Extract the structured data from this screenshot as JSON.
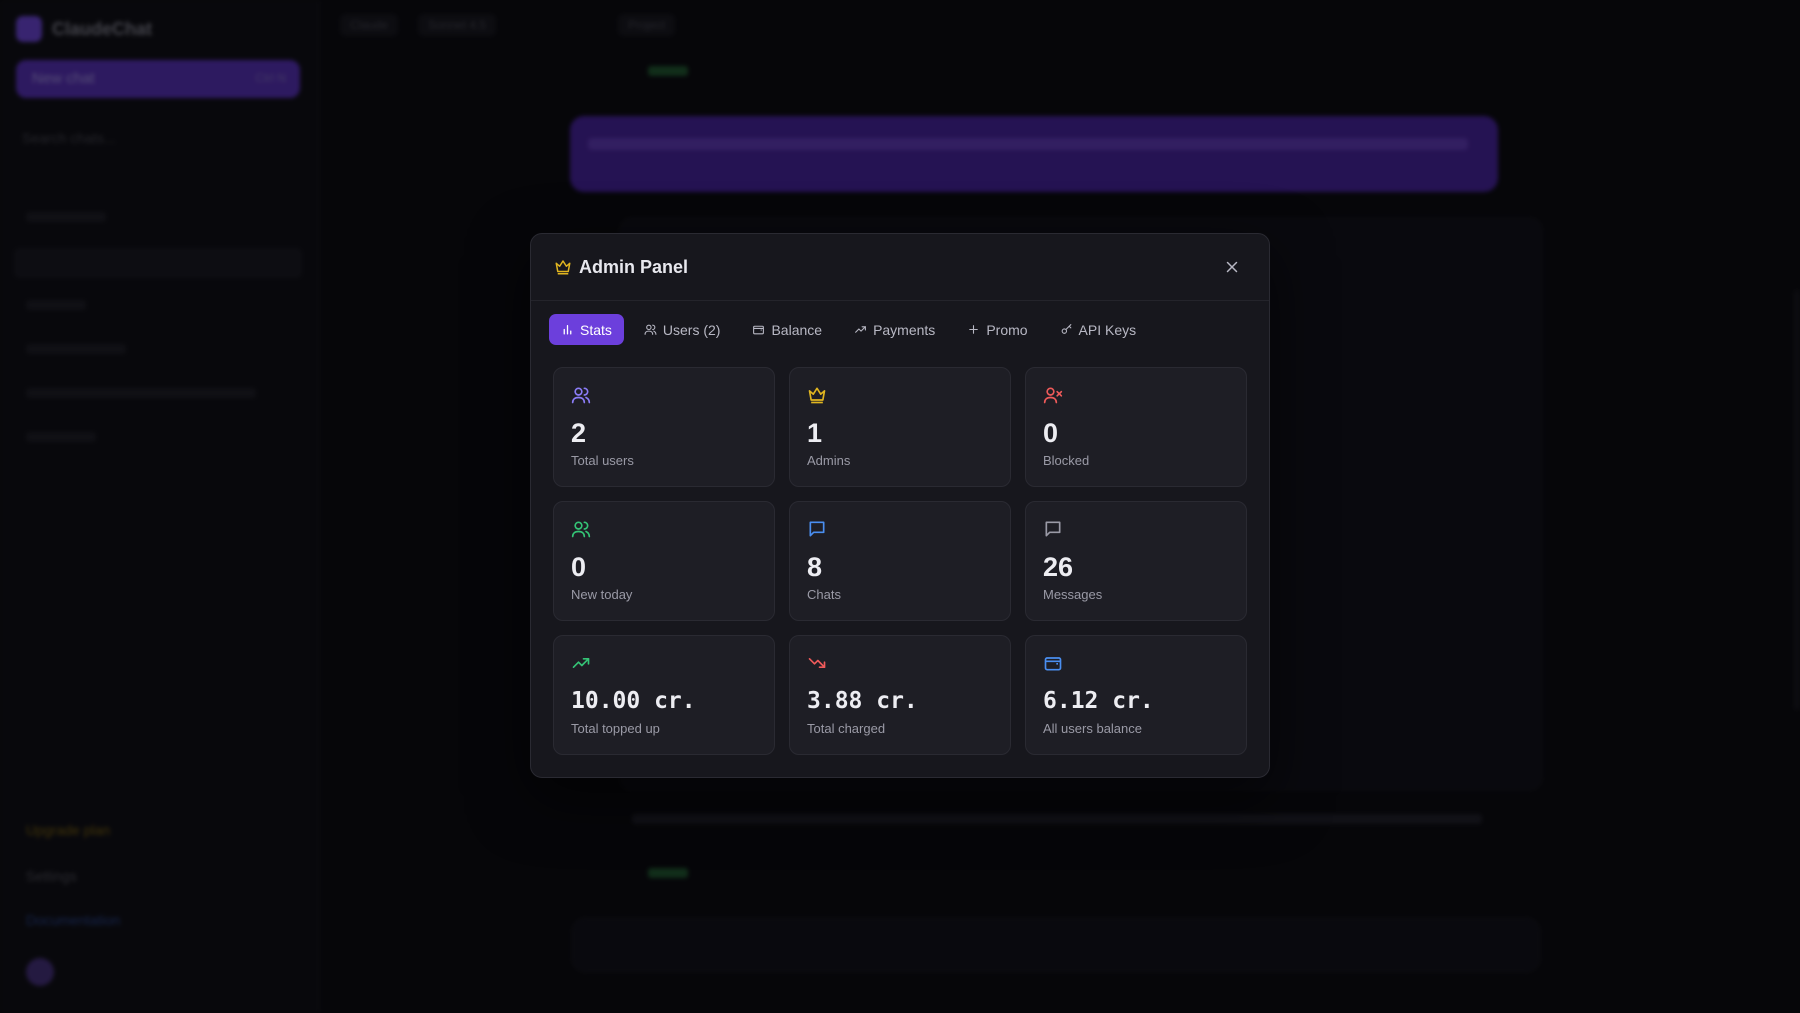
{
  "background_app": {
    "brand": "ClaudeChat",
    "new_chat": "New chat",
    "new_chat_shortcut": "Ctrl N",
    "search_placeholder": "Search chats...",
    "top_chips": [
      "Claude",
      "Sonnet 4.5",
      "Project"
    ],
    "sidebar_bottom": [
      "Upgrade plan",
      "Settings",
      "Documentation"
    ]
  },
  "modal": {
    "title": "Admin Panel",
    "close_icon": "close-icon",
    "accent_color": "#6c3fdc",
    "tabs": [
      {
        "label": "Stats",
        "icon": "bar-chart-icon",
        "active": true
      },
      {
        "label": "Users (2)",
        "icon": "users-icon",
        "active": false
      },
      {
        "label": "Balance",
        "icon": "wallet-icon",
        "active": false
      },
      {
        "label": "Payments",
        "icon": "trend-up-icon",
        "active": false
      },
      {
        "label": "Promo",
        "icon": "plus-icon",
        "active": false
      },
      {
        "label": "API Keys",
        "icon": "key-icon",
        "active": false
      }
    ],
    "stats": [
      {
        "value": "2",
        "label": "Total users",
        "icon": "users-icon",
        "color": "#8b7cf6"
      },
      {
        "value": "1",
        "label": "Admins",
        "icon": "crown-icon",
        "color": "#e0b520"
      },
      {
        "value": "0",
        "label": "Blocked",
        "icon": "user-x-icon",
        "color": "#ef5a5a"
      },
      {
        "value": "0",
        "label": "New today",
        "icon": "users-icon",
        "color": "#34c476"
      },
      {
        "value": "8",
        "label": "Chats",
        "icon": "message-square-icon",
        "color": "#4a8ef0"
      },
      {
        "value": "26",
        "label": "Messages",
        "icon": "message-square-icon",
        "color": "#9a9aa6"
      },
      {
        "value": "10.00 cr.",
        "label": "Total topped up",
        "icon": "trend-up-icon",
        "color": "#34c476"
      },
      {
        "value": "3.88 cr.",
        "label": "Total charged",
        "icon": "trend-down-icon",
        "color": "#ef5a5a"
      },
      {
        "value": "6.12 cr.",
        "label": "All users balance",
        "icon": "wallet-icon",
        "color": "#4a8ef0"
      }
    ]
  }
}
